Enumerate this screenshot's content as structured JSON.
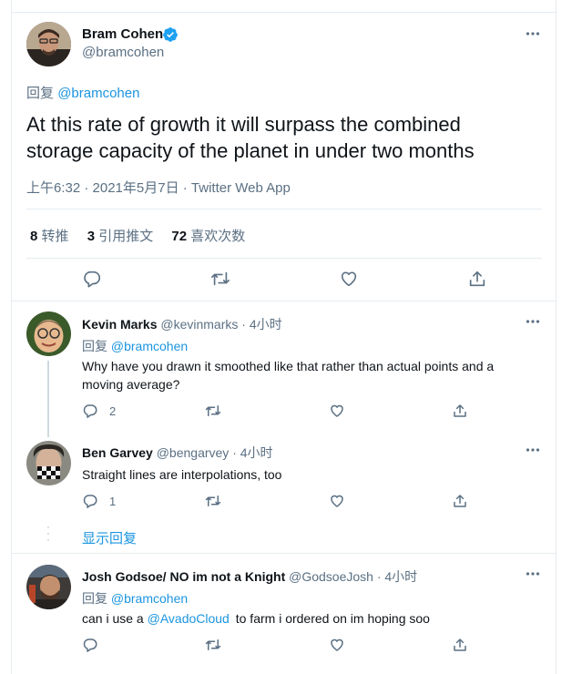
{
  "main_tweet": {
    "author_name": "Bram Cohen",
    "author_handle": "@bramcohen",
    "reply_prefix": "回复",
    "reply_to": "@bramcohen",
    "text_line1": "At this rate of growth it will surpass the combined",
    "text_line2": "storage capacity of the planet in under two months",
    "timestamp": "上午6:32 · 2021年5月7日 · Twitter Web App",
    "stats": {
      "retweets_count": "8",
      "retweets_label": "转推",
      "quotes_count": "3",
      "quotes_label": "引用推文",
      "likes_count": "72",
      "likes_label": "喜欢次数"
    }
  },
  "replies": [
    {
      "author_name": "Kevin Marks",
      "author_handle": "@kevinmarks",
      "time": "· 4小时",
      "reply_prefix": "回复",
      "reply_to": "@bramcohen",
      "text_line1": "Why have you drawn it smoothed like that rather than actual points and a",
      "text_line2": "moving average?",
      "reply_count": "2"
    },
    {
      "author_name": "Ben Garvey",
      "author_handle": "@bengarvey",
      "time": "· 4小时",
      "text_line1": "Straight lines are interpolations, too",
      "reply_count": "1"
    },
    {
      "author_name": "Josh Godsoe/ NO im not a Knight",
      "author_handle": "@GodsoeJosh",
      "time": "· 4小时",
      "reply_prefix": "回复",
      "reply_to": "@bramcohen",
      "text_pre": "can i use a",
      "text_mention": "@AvadoCloud",
      "text_post": "to farm i ordered on im hoping soo"
    }
  ],
  "show_replies_label": "显示回复",
  "colors": {
    "accent": "#1b95e0",
    "verified": "#1da1f2",
    "secondary_text": "#5b7083",
    "border": "#e6ecf0"
  },
  "icons": [
    "more-icon",
    "verified-icon",
    "reply-icon",
    "retweet-icon",
    "like-icon",
    "share-icon"
  ]
}
